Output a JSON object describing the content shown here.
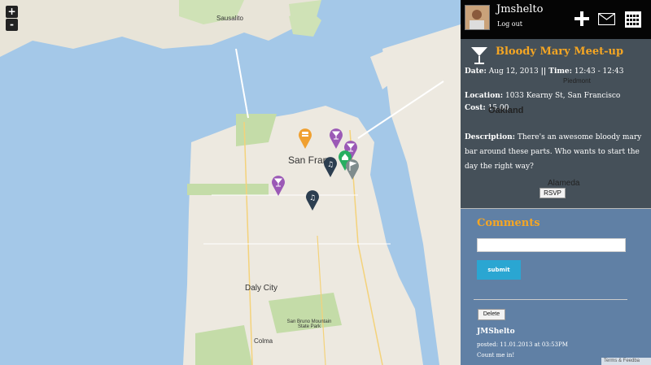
{
  "map": {
    "zoom_in": "+",
    "zoom_out": "-",
    "labels": {
      "sausalito": "Sausalito",
      "san_francisco": "San Fran",
      "daly_city": "Daly City",
      "colma": "Colma",
      "oakland": "Oakland",
      "alameda": "Alameda",
      "piedmont": "Piedmont",
      "golden_gate": "San Bruno Mountain State Park"
    },
    "markers": [
      {
        "name": "burger-marker",
        "color": "#f0a030",
        "icon": "burger-icon"
      },
      {
        "name": "cocktail-marker",
        "color": "#9b59b6",
        "icon": "cocktail-icon"
      },
      {
        "name": "cocktail-marker",
        "color": "#9b59b6",
        "icon": "cocktail-icon"
      },
      {
        "name": "music-marker",
        "color": "#2c3e50",
        "icon": "music-note-icon"
      },
      {
        "name": "home-marker",
        "color": "#27ae60",
        "icon": "home-icon"
      },
      {
        "name": "flag-marker",
        "color": "#7f8c8d",
        "icon": "flag-icon"
      },
      {
        "name": "cocktail-marker",
        "color": "#9b59b6",
        "icon": "cocktail-icon"
      },
      {
        "name": "music-marker",
        "color": "#2c3e50",
        "icon": "music-note-icon"
      }
    ],
    "terms": "Terms & Feedba"
  },
  "user": {
    "name": "Jmshelto",
    "logout": "Log out"
  },
  "toolbar": {
    "add_icon": "plus-icon",
    "mail_icon": "envelope-icon",
    "calendar_icon": "calendar-icon"
  },
  "event": {
    "title": "Bloody Mary Meet-up",
    "date_label": "Date:",
    "date": "Aug 12, 2013",
    "time_label": "|| Time:",
    "time": "12:43 - 12:43",
    "location_label": "Location:",
    "location": "1033 Kearny St, San Francisco",
    "cost_label": "Cost:",
    "cost": "15.00",
    "description_label": "Description:",
    "description": "There's an awesome bloody mary bar around these parts. Who wants to start the day the right way?",
    "rsvp": "RSVP"
  },
  "comments": {
    "heading": "Comments",
    "input_value": "",
    "submit": "submit",
    "delete": "Delete",
    "items": [
      {
        "author": "JMShelto",
        "posted": "posted: 11.01.2013 at 03:53PM",
        "text": "Count me in!"
      }
    ]
  },
  "colors": {
    "accent": "#f5a623",
    "submit_blue": "#2aa6d2",
    "water": "#a4c8e8",
    "land": "#ede9e0"
  }
}
